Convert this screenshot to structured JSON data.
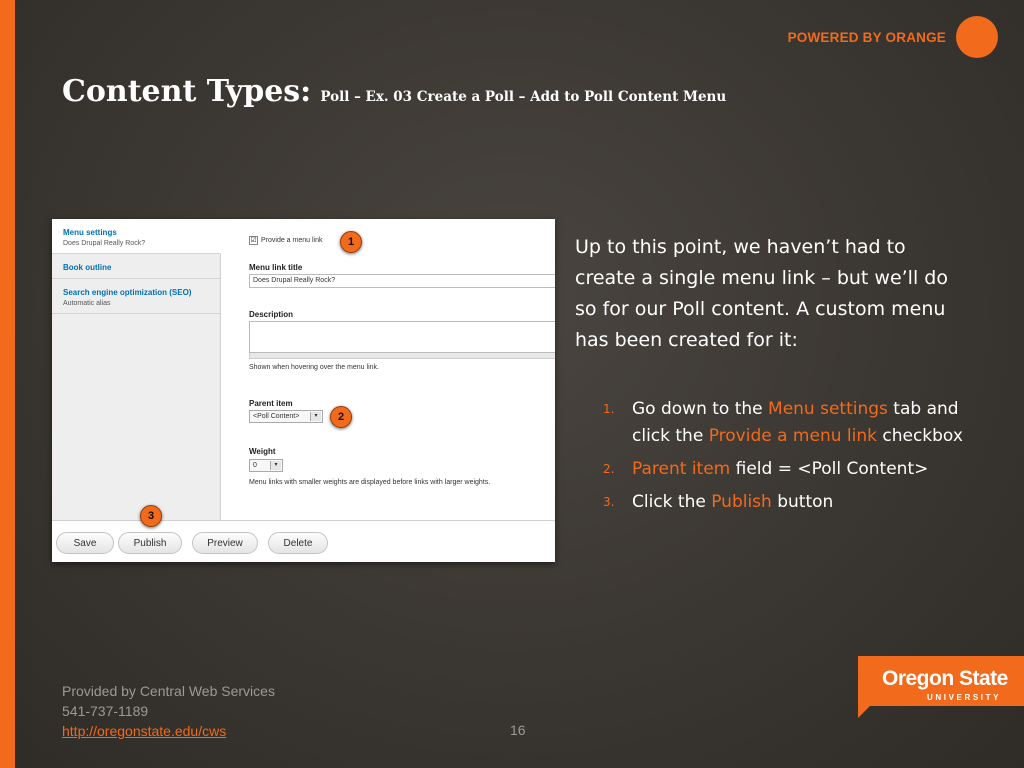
{
  "brand": {
    "powered": "POWERED BY ORANGE",
    "logo_name": "Oregon State",
    "logo_sub": "UNIVERSITY",
    "accent": "#f26a1b"
  },
  "slide": {
    "title": "Content Types:",
    "subtitle": "Poll – Ex. 03 Create a Poll – Add to Poll Content Menu",
    "intro": "Up to this point, we haven’t had to create a single menu link – but we’ll do so for our Poll content.  A custom menu has been created for it:",
    "steps": [
      {
        "num": "1.",
        "p1": "Go down to the ",
        "h1": "Menu settings",
        "p2": " tab and click the ",
        "h2": "Provide a menu link",
        "p3": " checkbox"
      },
      {
        "num": "2.",
        "h1": "Parent item",
        "p1": " field = <Poll Content>"
      },
      {
        "num": "3.",
        "p1": "Click the ",
        "h1": "Publish",
        "p2": " button"
      }
    ],
    "page_number": "16"
  },
  "footer": {
    "line1": "Provided by Central Web Services",
    "line2": "541-737-1189",
    "link": "http://oregonstate.edu/cws"
  },
  "screenshot": {
    "tabs": [
      {
        "title": "Menu settings",
        "sub": "Does Drupal Really Rock?"
      },
      {
        "title": "Book outline",
        "sub": ""
      },
      {
        "title": "Search engine optimization (SEO)",
        "sub": "Automatic alias"
      }
    ],
    "provide_link_label": "Provide a menu link",
    "provide_link_checked": "☑",
    "menu_link_title_label": "Menu link title",
    "menu_link_title_value": "Does Drupal Really Rock?",
    "description_label": "Description",
    "description_help": "Shown when hovering over the menu link.",
    "parent_item_label": "Parent item",
    "parent_item_value": "<Poll Content>",
    "weight_label": "Weight",
    "weight_value": "0",
    "weight_help": "Menu links with smaller weights are displayed before links with larger weights.",
    "buttons": [
      "Save",
      "Publish",
      "Preview",
      "Delete"
    ],
    "markers": [
      "1",
      "2",
      "3"
    ]
  }
}
